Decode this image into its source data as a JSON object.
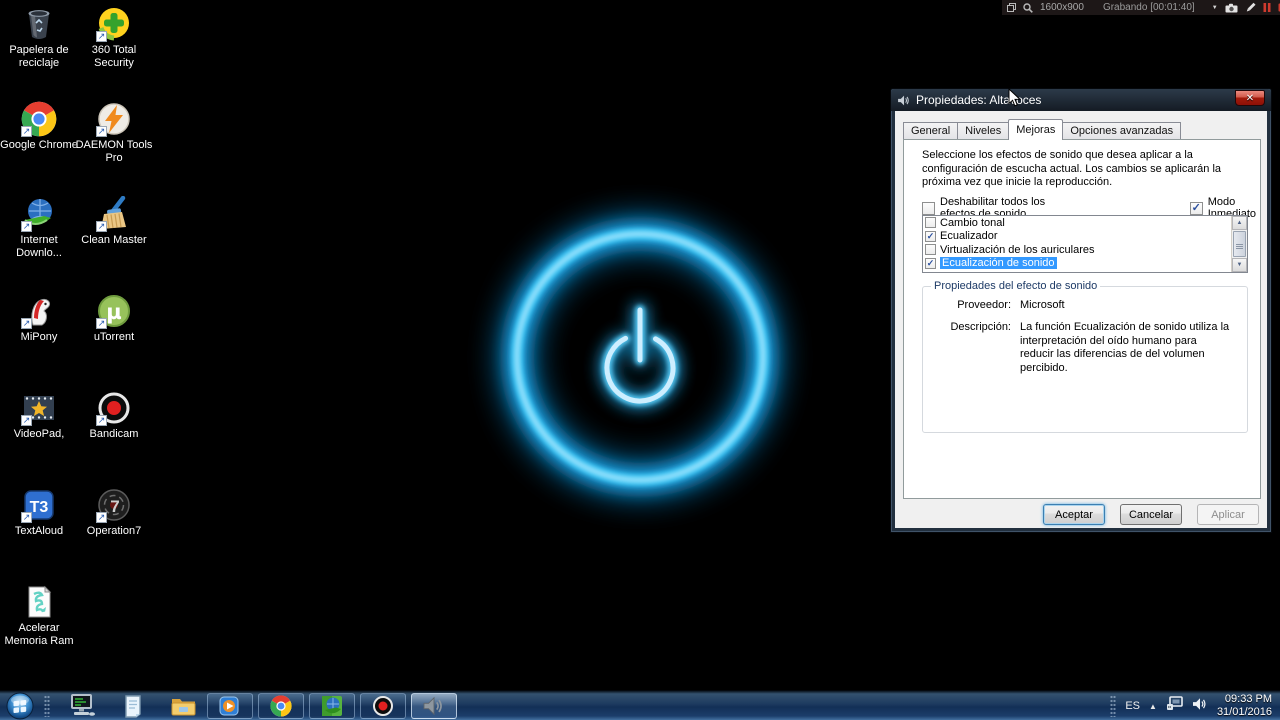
{
  "recording_bar": {
    "resolution": "1600x900",
    "status": "Grabando [00:01:40]"
  },
  "desktop": {
    "icons": [
      {
        "label": "Papelera de reciclaje",
        "icon": "recycle-bin"
      },
      {
        "label": "360 Total Security",
        "icon": "360-total-security"
      },
      {
        "label": "Google Chrome",
        "icon": "google-chrome"
      },
      {
        "label": "DAEMON Tools Pro",
        "icon": "daemon-tools-pro"
      },
      {
        "label": "Internet Downlo...",
        "icon": "internet-download-manager"
      },
      {
        "label": "Clean Master",
        "icon": "clean-master"
      },
      {
        "label": "MiPony",
        "icon": "mipony"
      },
      {
        "label": "uTorrent",
        "icon": "utorrent"
      },
      {
        "label": "VideoPad,",
        "icon": "videopad"
      },
      {
        "label": "Bandicam",
        "icon": "bandicam"
      },
      {
        "label": "TextAloud",
        "icon": "textaloud"
      },
      {
        "label": "Operation7",
        "icon": "operation7"
      },
      {
        "label": "Acelerar Memoria Ram",
        "icon": "vbs-script"
      }
    ]
  },
  "dialog": {
    "title": "Propiedades: Altavoces",
    "tabs": [
      {
        "label": "General"
      },
      {
        "label": "Niveles"
      },
      {
        "label": "Mejoras"
      },
      {
        "label": "Opciones avanzadas"
      }
    ],
    "intro": "Seleccione los efectos de sonido que desea aplicar a la configuración de escucha actual. Los cambios se aplicarán la próxima vez que inicie la reproducción.",
    "disable_all_label": "Deshabilitar todos los efectos de sonido",
    "immediate_mode_label": "Modo Inmediato",
    "effects": [
      {
        "label": "Cambio tonal",
        "checked": false,
        "selected": false
      },
      {
        "label": "Ecualizador",
        "checked": true,
        "selected": false
      },
      {
        "label": "Virtualización de los auriculares",
        "checked": false,
        "selected": false
      },
      {
        "label": "Ecualización de sonido",
        "checked": true,
        "selected": true
      }
    ],
    "properties_group": {
      "title": "Propiedades del efecto de sonido",
      "provider_label": "Proveedor:",
      "provider_value": "Microsoft",
      "description_label": "Descripción:",
      "description_value": "La función Ecualización de sonido utiliza la interpretación del oído humano para reducir las diferencias de del volumen percibido."
    },
    "buttons": {
      "ok": "Aceptar",
      "cancel": "Cancelar",
      "apply": "Aplicar"
    }
  },
  "taskbar": {
    "tray": {
      "language": "ES",
      "time": "09:33 PM",
      "date": "31/01/2016"
    }
  },
  "glyphs": {
    "close": "✕",
    "check": "✓",
    "up": "▲",
    "down": "▼",
    "hidden_icons": "▲",
    "chevron_down": "▼",
    "mu": "µ",
    "seven": "7",
    "t3": "T3"
  },
  "colors": {
    "selection_blue": "#3399ff",
    "power_glow": "#2fbdf2",
    "record_red": "#d03b2f"
  }
}
